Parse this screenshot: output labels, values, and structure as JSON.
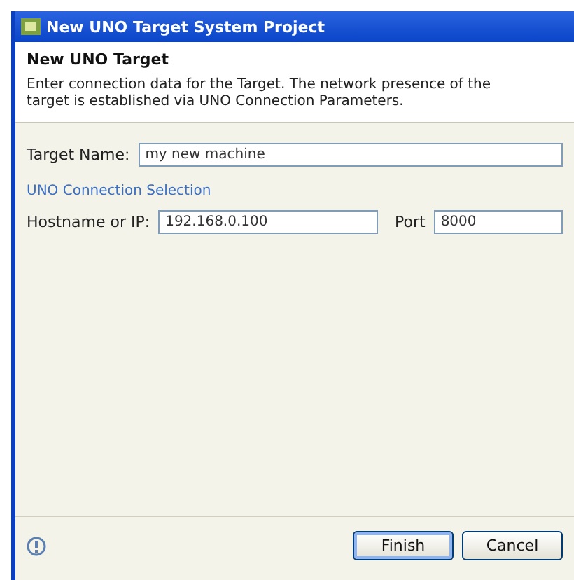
{
  "window": {
    "title": "New UNO Target System Project"
  },
  "header": {
    "title": "New UNO Target",
    "description": "Enter connection data for the Target. The network presence of the target is established via UNO Connection Parameters."
  },
  "target_name": {
    "label": "Target Name:",
    "value": "my new machine"
  },
  "connection": {
    "title": "UNO Connection Selection",
    "host": {
      "label": "Hostname or IP:",
      "value": "192.168.0.100"
    },
    "port": {
      "label": "Port",
      "value": "8000"
    }
  },
  "buttons": [
    {
      "label": "Finish",
      "kind": "default"
    },
    {
      "label": "Cancel",
      "kind": "normal"
    }
  ]
}
